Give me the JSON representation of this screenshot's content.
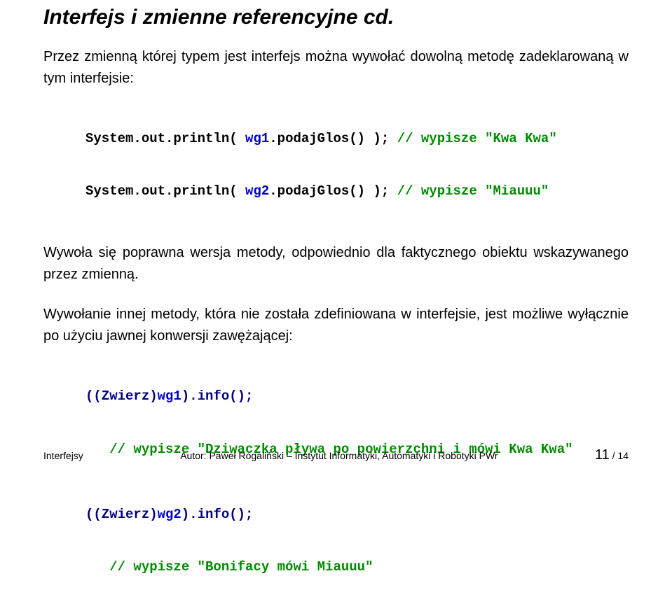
{
  "title": "Interfejs i zmienne referencyjne cd.",
  "para1": "Przez zmienną której typem jest interfejs można wywołać dowolną metodę zadeklarowaną w tym interfejsie:",
  "code1": {
    "prefix1": "System.out.println( ",
    "arg1": "wg1",
    "call1": ".podajGlos()",
    "suffix1": " ); ",
    "comment1": "// wypisze \"Kwa Kwa\"",
    "prefix2": "System.out.println( ",
    "arg2": "wg2",
    "call2": ".podajGlos()",
    "suffix2": " ); ",
    "comment2": "// wypisze \"Miauuu\""
  },
  "para2": "Wywoła się poprawna wersja metody, odpowiednio dla faktycznego obiektu wskazywanego przez zmienną.",
  "para3": "Wywołanie innej metody, która nie została zdefiniowana w interfejsie, jest możliwe wyłącznie po użyciu jawnej konwersji zawężającej:",
  "code2": {
    "cast1a": "((Zwierz)",
    "cast1b": "wg1",
    "cast1c": ").info();",
    "comment1": "   // wypisze \"Dziwaczka pływa po powierzchni i mówi Kwa Kwa\"",
    "cast2a": "((Zwierz)",
    "cast2b": "wg2",
    "cast2c": ").info();",
    "comment2": "   // wypisze \"Bonifacy mówi Miauuu\""
  },
  "footer": {
    "left": "Interfejsy",
    "center": "Autor: Paweł Rogaliński – Instytut Informatyki, Automatyki i Robotyki PWr",
    "page_current": "11",
    "page_sep": " / ",
    "page_total": "14"
  }
}
